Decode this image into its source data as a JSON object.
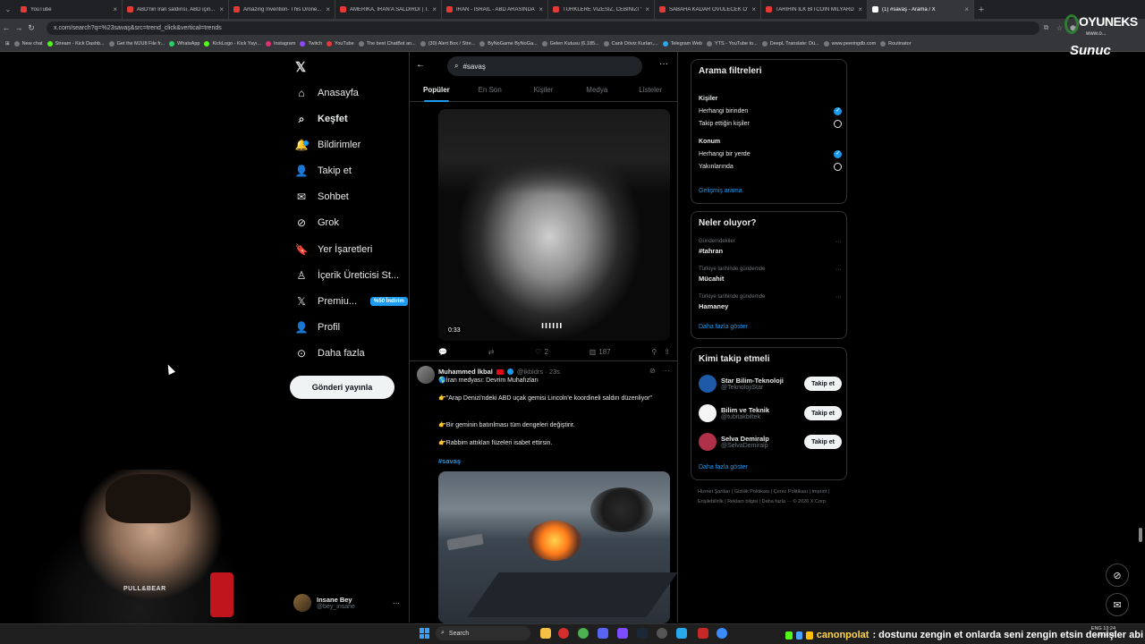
{
  "browser": {
    "tabs": [
      {
        "title": "YouTube",
        "active": false
      },
      {
        "title": "ABD'nin İran saldırısı, ABD için...",
        "active": false
      },
      {
        "title": "Amazing Invention- This Drone...",
        "active": false
      },
      {
        "title": "AMERİKA, İRAN'A SALDIRDI | T...",
        "active": false
      },
      {
        "title": "İRAN - İSRAİL - ABD ARASINDA...",
        "active": false
      },
      {
        "title": "TÜRKLERE VİZESİZ, CEBİNİZİ YE...",
        "active": false
      },
      {
        "title": "SABAHA KADAR ÖVÜLECEK OY...",
        "active": false
      },
      {
        "title": "TARİHİN İLK BİTCOİN MİLYARDE...",
        "active": false
      },
      {
        "title": "(1) #savaş - Arama / X",
        "active": true
      }
    ],
    "url": "x.com/search?q=%23savaş&src=trend_click&vertical=trends",
    "bookmarks": [
      "New chat",
      "Stream - Kick Dashb...",
      "Get the MJU8 File fr...",
      "WhatsApp",
      "KickLogo - Kick Yayı...",
      "Instagram",
      "Twitch",
      "YouTube",
      "The best ChatBot an...",
      "(30) Alert Box / Stre...",
      "ByNoGame ByNoGa...",
      "Gelen Kutusu (6.185...",
      "Canlı Döviz Kurları,...",
      "Telegram Web",
      "YTS - YouTube to...",
      "DeepL Translate: Dü...",
      "www.peeringdb.com",
      "Routinator"
    ]
  },
  "sidebar": {
    "items": [
      {
        "label": "Anasayfa",
        "icon": "home-icon",
        "glyph": "⌂",
        "bold": false
      },
      {
        "label": "Keşfet",
        "icon": "search-icon",
        "glyph": "⌕",
        "bold": true
      },
      {
        "label": "Bildirimler",
        "icon": "bell-icon",
        "glyph": "🔔",
        "bold": false
      },
      {
        "label": "Takip et",
        "icon": "add-person-icon",
        "glyph": "👤",
        "bold": false
      },
      {
        "label": "Sohbet",
        "icon": "mail-icon",
        "glyph": "✉",
        "bold": false
      },
      {
        "label": "Grok",
        "icon": "grok-icon",
        "glyph": "⊘",
        "bold": false
      },
      {
        "label": "Yer İşaretleri",
        "icon": "bookmark-icon",
        "glyph": "🔖",
        "bold": false
      },
      {
        "label": "İçerik Üreticisi St...",
        "icon": "creator-icon",
        "glyph": "♙",
        "bold": false
      },
      {
        "label": "Premiu...",
        "icon": "x-premium-icon",
        "glyph": "𝕏",
        "bold": false
      },
      {
        "label": "Profil",
        "icon": "person-icon",
        "glyph": "👤",
        "bold": false
      },
      {
        "label": "Daha fazla",
        "icon": "more-circle-icon",
        "glyph": "⊙",
        "bold": false
      }
    ],
    "premium_badge": "%50 İndirim",
    "post_button": "Gönderi yayınla",
    "user": {
      "name": "Insane Bey",
      "handle": "@bey_insane"
    }
  },
  "search": {
    "query": "#savaş",
    "tabs": [
      "Popüler",
      "En Son",
      "Kişiler",
      "Medya",
      "Listeler"
    ],
    "active_tab": "Popüler"
  },
  "tweet1": {
    "video_time": "0:33",
    "video_caption": "ıııııı",
    "replies": "",
    "reposts": "",
    "likes": "2",
    "views": "187"
  },
  "tweet2": {
    "name": "Muhammed İkbal",
    "handle": "@ikbldrs",
    "time": "23s",
    "lines": [
      "🌎İran medyası: Devrim Muhafızları",
      "👉\"Arap Denizi'ndeki ABD uçak gemisi Lincoln'e koordineli saldırı düzenliyor\"",
      "👉Bir geminin batırılması tüm dengeleri değiştirir.",
      "👉Rabbim attıkları füzeleri isabet ettirsin."
    ],
    "hashtag": "#savaş"
  },
  "filters": {
    "title": "Arama filtreleri",
    "people_label": "Kişiler",
    "people_options": [
      {
        "label": "Herhangi birinden",
        "selected": true
      },
      {
        "label": "Takip ettiğin kişiler",
        "selected": false
      }
    ],
    "location_label": "Konum",
    "location_options": [
      {
        "label": "Herhangi bir yerde",
        "selected": true
      },
      {
        "label": "Yakınlarında",
        "selected": false
      }
    ],
    "advanced_link": "Gelişmiş arama"
  },
  "trends": {
    "title": "Neler oluyor?",
    "items": [
      {
        "context": "Gündemdekiler",
        "name": "#tahran"
      },
      {
        "context": "Türkiye tarihinde gündemde",
        "name": "Mücahit"
      },
      {
        "context": "Türkiye tarihinde gündemde",
        "name": "Hamaney"
      }
    ],
    "show_more": "Daha fazla göster"
  },
  "who_to_follow": {
    "title": "Kimi takip etmeli",
    "items": [
      {
        "name": "Star Bilim-Teknoloji",
        "handle": "@TeknolojiStar",
        "button": "Takip et",
        "color": "#1e5aa8"
      },
      {
        "name": "Bilim ve Teknik",
        "handle": "@tubitakbiltek",
        "button": "Takip et",
        "color": "#f5f5f5"
      },
      {
        "name": "Selva Demiralp",
        "handle": "@SelvaDemiralp",
        "button": "Takip et",
        "color": "#b0304a"
      }
    ],
    "show_more": "Daha fazla göster"
  },
  "footer": "Hizmet Şartları | Gizlilik Politikası | Çerez Politikası | Imprint | Erişilebilirlik | Reklam bilgisi | Daha fazla ··· © 2026 X Corp.",
  "overlay": {
    "brand_top": "OYUNEKS",
    "brand_www": "www.o...",
    "brand_bottom": "Sunuc",
    "webcam_shirt": "PULL&BEAR",
    "chat_user": "canonpolat",
    "chat_message": ": dostunu zengin et onlarda seni zengin etsin demişler abi"
  },
  "taskbar": {
    "search_placeholder": "Search",
    "lang": "ENG",
    "time": "13:24",
    "date": "...03.2026"
  },
  "colors": {
    "accent": "#1d9bf0",
    "background": "#000000",
    "border": "#2f3336",
    "muted": "#71767b"
  }
}
